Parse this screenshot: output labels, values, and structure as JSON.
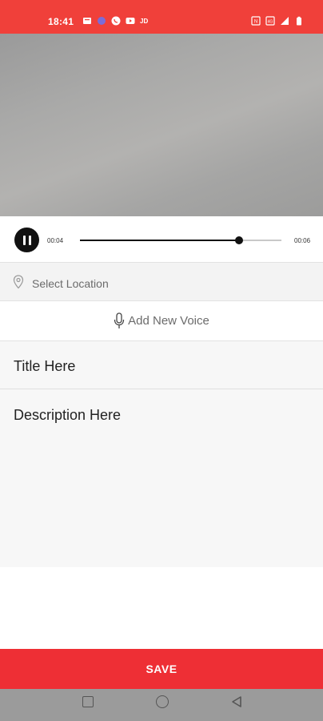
{
  "status_bar": {
    "time": "18:41",
    "background": "#f0403a",
    "left_icons": [
      "message-icon",
      "app-icon",
      "whatsapp-icon",
      "youtube-icon",
      "jio-icon"
    ],
    "right_icons": [
      "volte-icon",
      "signal-icon",
      "wifi-signal-icon",
      "battery-icon"
    ],
    "carrier_label": "JD"
  },
  "player": {
    "current_time": "00:04",
    "total_time": "00:06",
    "progress": 0.79,
    "state": "playing"
  },
  "location": {
    "placeholder": "Select Location",
    "icon": "location-pin-icon"
  },
  "voice": {
    "label": "Add New Voice",
    "icon": "microphone-icon"
  },
  "form": {
    "title_placeholder": "Title Here",
    "description_placeholder": "Description Here"
  },
  "save": {
    "label": "SAVE",
    "color": "#ee2f35"
  },
  "nav": {
    "icons": [
      "recents-icon",
      "home-icon",
      "back-icon"
    ]
  }
}
